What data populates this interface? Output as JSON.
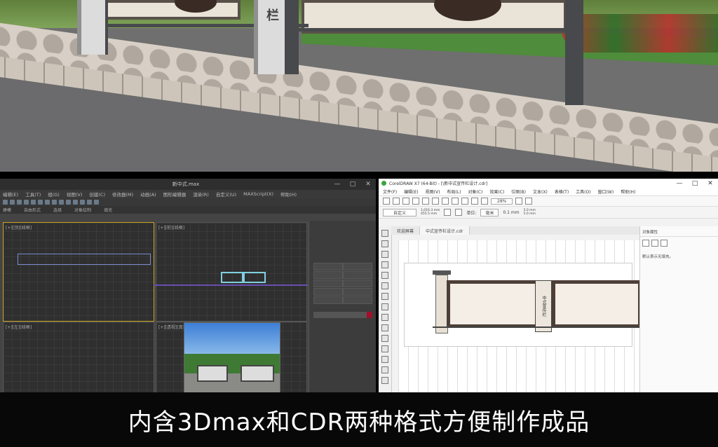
{
  "scene": {
    "sign_char": "栏"
  },
  "max_window": {
    "title": "新中式.max",
    "menu": [
      "编辑(E)",
      "工具(T)",
      "组(G)",
      "视图(V)",
      "创建(C)",
      "修改器(M)",
      "动画(A)",
      "图形编辑器",
      "渲染(R)",
      "自定义(U)",
      "MAXScript(X)",
      "帮助(H)"
    ],
    "subtoolbar": [
      "建模",
      "自由形式",
      "选择",
      "对象绘制",
      "填充"
    ],
    "viewport_labels": [
      "[+][顶][线框]",
      "[+][前][线框]",
      "[+][左][线框]",
      "[+][透视][真实]"
    ],
    "controls": [
      "—",
      "□",
      "✕"
    ]
  },
  "cdr_window": {
    "title": "CorelDRAW X7 (64-Bit) - [\\新中式宣传栏设计.cdr]",
    "menu": [
      "文件(F)",
      "编辑(E)",
      "视图(V)",
      "布局(L)",
      "对象(C)",
      "效果(C)",
      "位图(B)",
      "文本(X)",
      "表格(T)",
      "工具(O)",
      "窗口(W)",
      "帮助(H)"
    ],
    "zoom": "28%",
    "paper": "自定义",
    "size_w": "1,016.3 mm",
    "size_h": "455.5 mm",
    "unit_label": "单位:",
    "unit": "毫米",
    "nudge": "0.1 mm",
    "dup_x": "5.0 mm",
    "dup_y": "5.0 mm",
    "tabs": [
      "欢迎屏幕",
      "中式宣传栏设计.cdr"
    ],
    "docker_title": "对象属性",
    "docker_text": "默认表示无填充。",
    "panel_chars": "中式宣传栏",
    "controls": [
      "—",
      "□",
      "✕"
    ]
  },
  "caption": {
    "text": "内含3Dmax和CDR两种格式方便制作成品"
  }
}
